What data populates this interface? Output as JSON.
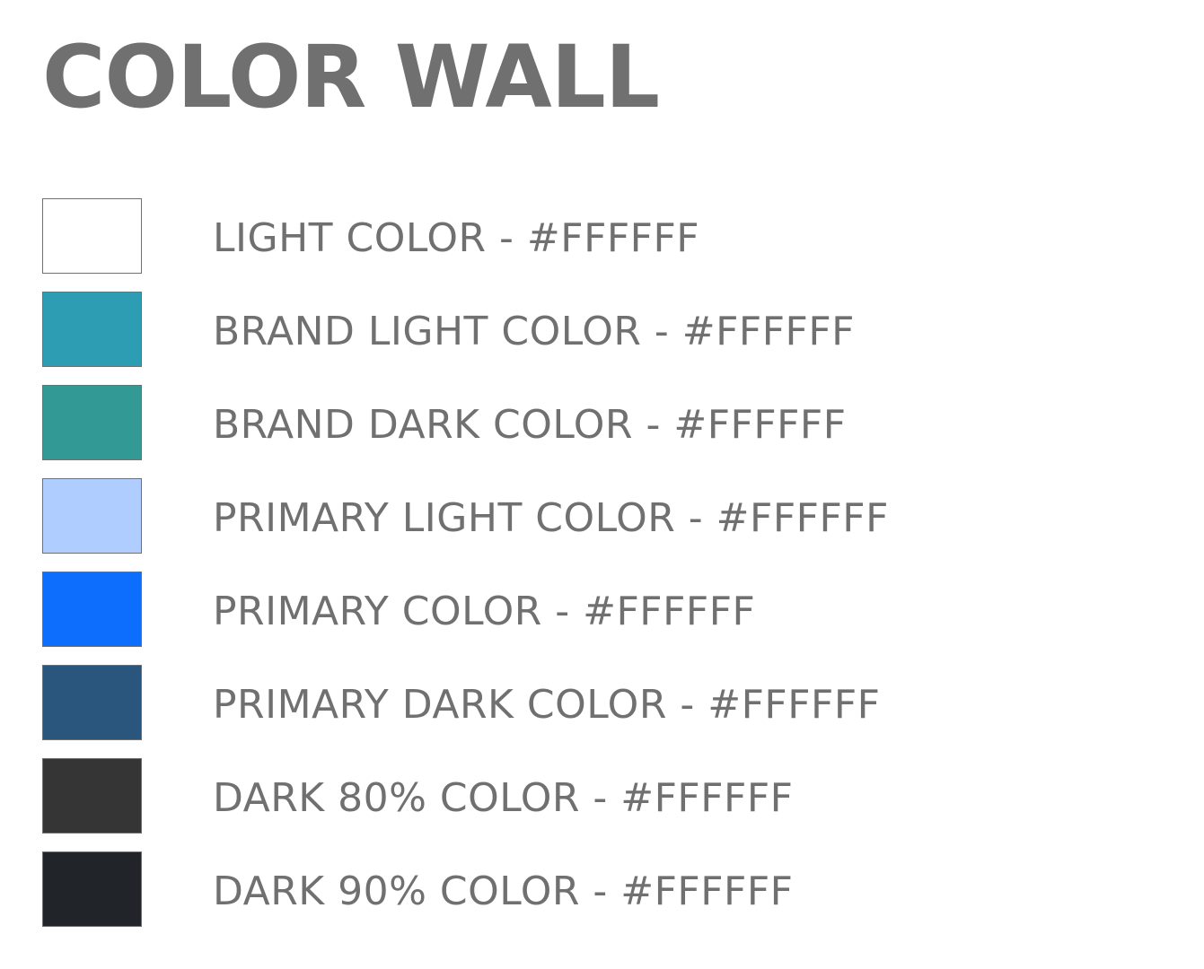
{
  "title": "COLOR WALL",
  "swatches": [
    {
      "label": "LIGHT COLOR - #FFFFFF",
      "color": "#FFFFFF"
    },
    {
      "label": "BRAND LIGHT COLOR - #FFFFFF",
      "color": "#2C9DB3"
    },
    {
      "label": "BRAND DARK COLOR - #FFFFFF",
      "color": "#339994"
    },
    {
      "label": "PRIMARY LIGHT COLOR - #FFFFFF",
      "color": "#AFCDFF"
    },
    {
      "label": "PRIMARY COLOR - #FFFFFF",
      "color": "#0D6EFD"
    },
    {
      "label": "PRIMARY DARK COLOR - #FFFFFF",
      "color": "#2A557D"
    },
    {
      "label": "DARK 80% COLOR - #FFFFFF",
      "color": "#353535"
    },
    {
      "label": "DARK 90% COLOR - #FFFFFF",
      "color": "#212529"
    }
  ]
}
